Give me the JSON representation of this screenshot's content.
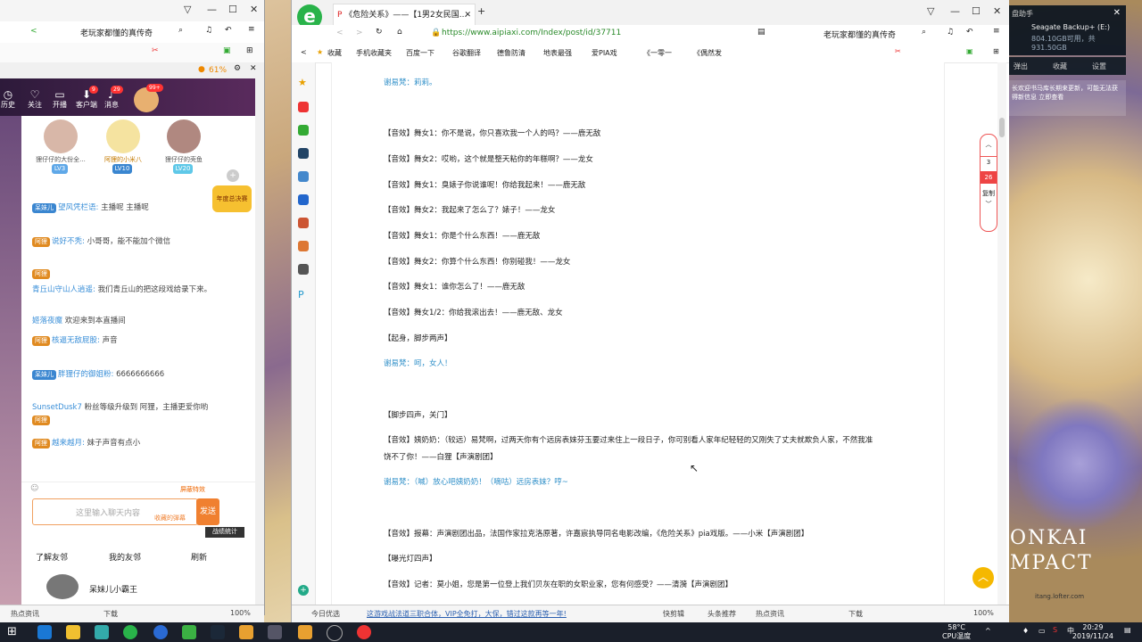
{
  "left_window": {
    "tab_title": "老玩家都懂的真传奇",
    "battery": "61%",
    "nav": [
      {
        "label": "历史",
        "icon": "clock-icon"
      },
      {
        "label": "关注",
        "icon": "heart-icon",
        "badge": "1"
      },
      {
        "label": "开播",
        "icon": "camera-icon"
      },
      {
        "label": "客户端",
        "icon": "download-icon",
        "badge": "9"
      },
      {
        "label": "消息",
        "icon": "bell-icon",
        "badge": "29"
      }
    ],
    "avatar_badge": "99+",
    "fans": [
      {
        "name": "狸仔仔的大份全...",
        "level": "LV3"
      },
      {
        "name": "阿狸的小米八",
        "level": "LV10"
      },
      {
        "name": "狸仔仔的壳鱼",
        "level": "LV20"
      }
    ],
    "messages": [
      {
        "user": "望风凭栏语:",
        "text": "主播呢 主播呢",
        "fan": "呆妹儿"
      },
      {
        "user": "说好不秃:",
        "text": "小哥哥，能不能加个微信",
        "fan": "阿狸"
      },
      {
        "user": "青丘山守山人逍遥:",
        "text": "我们青丘山的把这段戏给录下来。",
        "fan": "阿狸"
      },
      {
        "user": "姬落夜魔",
        "text": "欢迎来到本直播间",
        "fan": ""
      },
      {
        "user": "核逼无敌屁股:",
        "text": "声音",
        "fan": "阿狸"
      },
      {
        "user": "胖狸仔的御姐粉:",
        "text": "6666666666",
        "fan": "呆妹儿"
      },
      {
        "user": "SunsetDusk7",
        "text": "粉丝等级升级到 阿狸，主播更爱你哟",
        "fan": "阿狸"
      },
      {
        "user": "越来越月:",
        "text": "妹子声音有点小",
        "fan": "阿狸"
      }
    ],
    "shield_label": "屏蔽特效",
    "input_placeholder": "这里输入聊天内容",
    "send_label": "发送",
    "send_hint": "收藏的弹幕",
    "stats_label": "战绩统计",
    "year_badge": "年度总决赛",
    "friends_tabs": [
      "了解友邻",
      "我的友邻",
      "刷新"
    ],
    "friend_name": "呆妹儿小霸王",
    "status_items": [
      "热点资讯",
      "下载"
    ],
    "zoom": "100%"
  },
  "right_window": {
    "tab_title": "《危险关系》——【1男2女民国...",
    "url": "https://www.aipiaxi.com/Index/post/id/37711",
    "search_text": "老玩家都懂的真传奇",
    "favorites": [
      "收藏",
      "手机收藏夹",
      "百度一下",
      "谷歌翻译",
      "德鲁防清",
      "地表最强",
      "爱PIA戏",
      "《一零一",
      "《偶然发"
    ],
    "lines": [
      {
        "text": "谢易梵：莉莉。",
        "style": "blue"
      },
      {
        "text": "",
        "style": ""
      },
      {
        "text": "【音效】舞女1：你不是说，你只喜欢我一个人的吗？——鹿无敌",
        "style": ""
      },
      {
        "text": "【音效】舞女2：哎哟，这个就是整天粘你的年糕啊？——龙女",
        "style": ""
      },
      {
        "text": "【音效】舞女1：臭婊子你说谁呢！你给我起来！——鹿无敌",
        "style": ""
      },
      {
        "text": "【音效】舞女2：我起来了怎么了？婊子！——龙女",
        "style": ""
      },
      {
        "text": "【音效】舞女1：你是个什么东西！——鹿无敌",
        "style": ""
      },
      {
        "text": "【音效】舞女2：你算个什么东西！你别碰我！——龙女",
        "style": ""
      },
      {
        "text": "【音效】舞女1：谁你怎么了！——鹿无敌",
        "style": ""
      },
      {
        "text": "【音效】舞女1/2：你给我滚出去！——鹿无敌、龙女",
        "style": ""
      },
      {
        "text": "【起身，脚步两声】",
        "style": ""
      },
      {
        "text": "谢易梵：呵，女人！",
        "style": "blue"
      },
      {
        "text": "",
        "style": ""
      },
      {
        "text": "【脚步四声，关门】",
        "style": ""
      },
      {
        "text": "【音效】姨奶奶：（较远）易梵啊，过两天你有个远房表妹芬玉要过来住上一段日子，你可别看人家年纪轻轻的又刚失了丈夫就欺负人家，不然我准",
        "style": ""
      },
      {
        "text": "饶不了你！——白狸【声演剧团】",
        "style": ""
      },
      {
        "text": "谢易梵：（喊）放心吧姨奶奶！（嘀咕）远房表妹？哼~",
        "style": "blue"
      },
      {
        "text": "",
        "style": ""
      },
      {
        "text": "【音效】报幕：声演剧团出品，法国作家拉克洛原著，许嘉宸执导同名电影改编，《危险关系》pia戏版。——小米【声演剧团】",
        "style": ""
      },
      {
        "text": "【曝光灯四声】",
        "style": ""
      },
      {
        "text": "【音效】记者：莫小姐，您是第一位登上我们贝灰在职的女职业家，您有何感受？——清漪【声演剧团】",
        "style": ""
      }
    ],
    "pager": [
      "3",
      "26",
      "复制"
    ],
    "status_items": [
      "今日优选",
      "这游戏战法道三职合体，VIP全免打，大保，错过这款再等一年!",
      "快剪辑",
      "头条推荐",
      "热点资讯",
      "下载"
    ],
    "zoom": "100%"
  },
  "device_widget": {
    "title": "盘助手",
    "drive": "Seagate Backup+ (E:)",
    "size": "804.10GB可用，共931.50GB",
    "actions": [
      "弹出",
      "收藏",
      "设置"
    ]
  },
  "notification": "长欢迎书马库长期来更新，可能无法获得新信息 立即查看",
  "wallpaper": {
    "logo_line1": "ONKAI",
    "logo_line2": "MPACT",
    "url": "itang.lofter.com"
  },
  "taskbar": {
    "temp": "58°C",
    "temp_label": "CPU温度",
    "time": "20:29",
    "date": "2019/11/24"
  }
}
